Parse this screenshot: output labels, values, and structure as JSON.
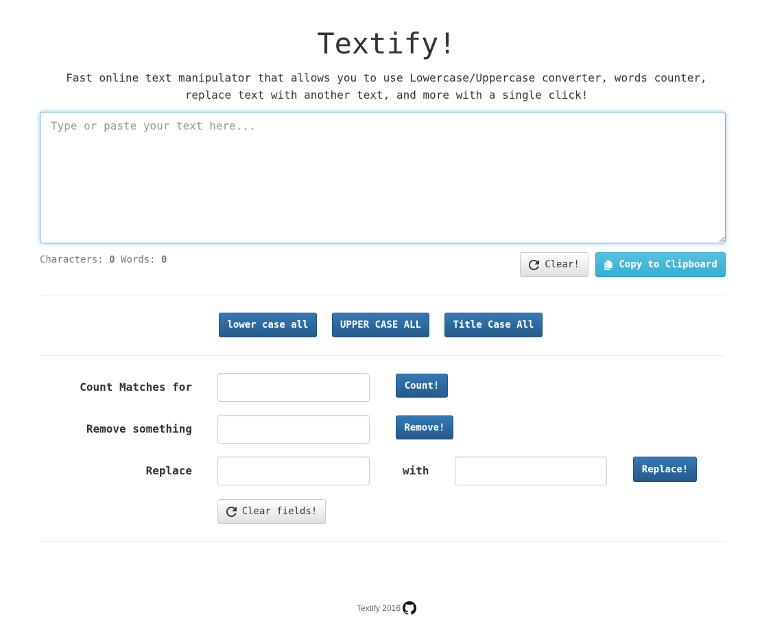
{
  "header": {
    "title": "Textify!",
    "subtitle_line1": "Fast online text manipulator that allows you to use Lowercase/Uppercase converter, words counter,",
    "subtitle_line2": "replace text with another text, and more with a single click!"
  },
  "editor": {
    "placeholder": "Type or paste your text here...",
    "value": ""
  },
  "stats": {
    "characters_label": "Characters:",
    "characters_value": "0",
    "words_label": "Words:",
    "words_value": "0"
  },
  "actions": {
    "clear_label": "Clear!",
    "copy_label": "Copy to Clipboard"
  },
  "case_buttons": {
    "lower": "lower case all",
    "upper": "UPPER CASE ALL",
    "title": "Title Case All"
  },
  "tools": {
    "count_label": "Count Matches for",
    "count_button": "Count!",
    "remove_label": "Remove something",
    "remove_button": "Remove!",
    "replace_label": "Replace",
    "with_label": "with",
    "replace_button": "Replace!",
    "clear_fields_button": "Clear fields!"
  },
  "footer": {
    "text": "Textify 2016"
  },
  "colors": {
    "primary": "#286090",
    "info": "#46b8da",
    "focus_border": "#66afe9"
  },
  "icons": {
    "refresh": "refresh-icon",
    "copy": "copy-icon",
    "github": "github-icon"
  }
}
